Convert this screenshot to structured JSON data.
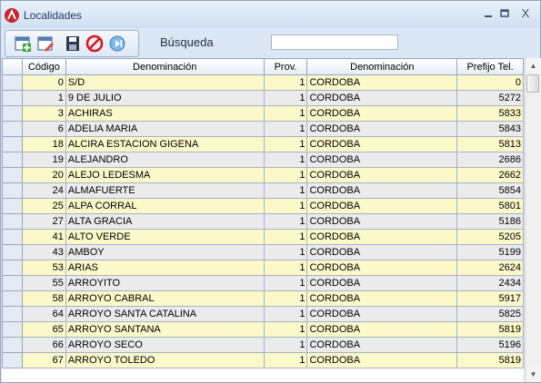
{
  "window": {
    "title": "Localidades",
    "minimize": "▭",
    "maximize": "▬",
    "close": "X"
  },
  "toolbar": {
    "buttons": [
      "new-record-icon",
      "edit-record-icon",
      "save-icon",
      "cancel-icon",
      "exit-icon"
    ],
    "search_label": "Búsqueda",
    "search_value": ""
  },
  "grid": {
    "columns": [
      "Código",
      "Denominación",
      "Prov.",
      "Denominación",
      "Prefijo Tel."
    ],
    "rows": [
      [
        "0",
        "S/D",
        "1",
        "CORDOBA",
        "0"
      ],
      [
        "1",
        "9 DE JULIO",
        "1",
        "CORDOBA",
        "5272"
      ],
      [
        "3",
        "ACHIRAS",
        "1",
        "CORDOBA",
        "5833"
      ],
      [
        "6",
        "ADELIA MARIA",
        "1",
        "CORDOBA",
        "5843"
      ],
      [
        "18",
        "ALCIRA ESTACION GIGENA",
        "1",
        "CORDOBA",
        "5813"
      ],
      [
        "19",
        "ALEJANDRO",
        "1",
        "CORDOBA",
        "2686"
      ],
      [
        "20",
        "ALEJO LEDESMA",
        "1",
        "CORDOBA",
        "2662"
      ],
      [
        "24",
        "ALMAFUERTE",
        "1",
        "CORDOBA",
        "5854"
      ],
      [
        "25",
        "ALPA CORRAL",
        "1",
        "CORDOBA",
        "5801"
      ],
      [
        "27",
        "ALTA GRACIA",
        "1",
        "CORDOBA",
        "5186"
      ],
      [
        "41",
        "ALTO VERDE",
        "1",
        "CORDOBA",
        "5205"
      ],
      [
        "43",
        "AMBOY",
        "1",
        "CORDOBA",
        "5199"
      ],
      [
        "53",
        "ARIAS",
        "1",
        "CORDOBA",
        "2624"
      ],
      [
        "55",
        "ARROYITO",
        "1",
        "CORDOBA",
        "2434"
      ],
      [
        "58",
        "ARROYO CABRAL",
        "1",
        "CORDOBA",
        "5917"
      ],
      [
        "64",
        "ARROYO SANTA CATALINA",
        "1",
        "CORDOBA",
        "5825"
      ],
      [
        "65",
        "ARROYO SANTANA",
        "1",
        "CORDOBA",
        "5819"
      ],
      [
        "66",
        "ARROYO SECO",
        "1",
        "CORDOBA",
        "5196"
      ],
      [
        "67",
        "ARROYO TOLEDO",
        "1",
        "CORDOBA",
        "5819"
      ]
    ]
  },
  "colors": {
    "row_odd": "#fbf8c9",
    "row_even": "#ebebeb",
    "title_text": "#1f3b64"
  }
}
